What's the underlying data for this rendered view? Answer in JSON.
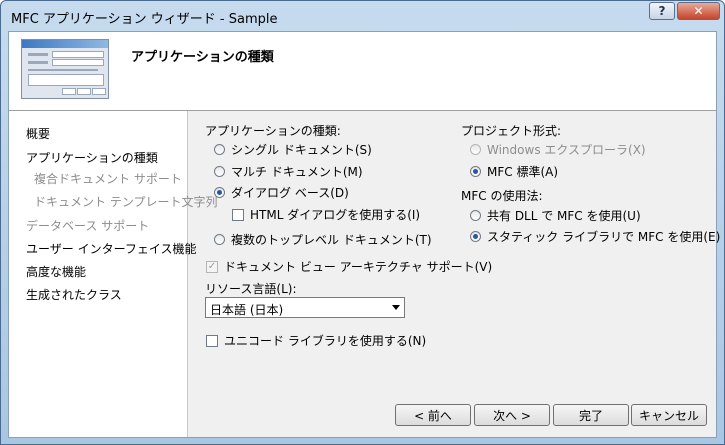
{
  "window": {
    "title": "MFC アプリケーション ウィザード - Sample",
    "help": "?",
    "close": "✕"
  },
  "header": {
    "title": "アプリケーションの種類"
  },
  "sidebar": {
    "items": [
      {
        "label": "概要",
        "enabled": true
      },
      {
        "label": "アプリケーションの種類",
        "enabled": true
      },
      {
        "label": "複合ドキュメント サポート",
        "enabled": false
      },
      {
        "label": "ドキュメント テンプレート文字列",
        "enabled": false
      },
      {
        "label": "データベース サポート",
        "enabled": false
      },
      {
        "label": "ユーザー インターフェイス機能",
        "enabled": true
      },
      {
        "label": "高度な機能",
        "enabled": true
      },
      {
        "label": "生成されたクラス",
        "enabled": true
      }
    ]
  },
  "app_type": {
    "label": "アプリケーションの種類:",
    "options": [
      {
        "label": "シングル ドキュメント(S)",
        "selected": false
      },
      {
        "label": "マルチ ドキュメント(M)",
        "selected": false
      },
      {
        "label": "ダイアログ ベース(D)",
        "selected": true
      },
      {
        "label": "複数のトップレベル ドキュメント(T)",
        "selected": false
      }
    ],
    "html_dialog": {
      "label": "HTML ダイアログを使用する(I)",
      "checked": false
    }
  },
  "doc_view": {
    "label": "ドキュメント ビュー アーキテクチャ サポート(V)",
    "checked": true,
    "enabled": false
  },
  "resource_lang": {
    "label": "リソース言語(L):",
    "value": "日本語 (日本)"
  },
  "unicode": {
    "label": "ユニコード ライブラリを使用する(N)",
    "checked": false
  },
  "project_style": {
    "label": "プロジェクト形式:",
    "options": [
      {
        "label": "Windows エクスプローラ(X)",
        "selected": false,
        "enabled": false
      },
      {
        "label": "MFC 標準(A)",
        "selected": true,
        "enabled": true
      }
    ]
  },
  "mfc_use": {
    "label": "MFC の使用法:",
    "options": [
      {
        "label": "共有 DLL で MFC を使用(U)",
        "selected": false
      },
      {
        "label": "スタティック ライブラリで MFC を使用(E)",
        "selected": true
      }
    ]
  },
  "buttons": {
    "back": "< 前へ",
    "next": "次へ >",
    "finish": "完了",
    "cancel": "キャンセル"
  }
}
